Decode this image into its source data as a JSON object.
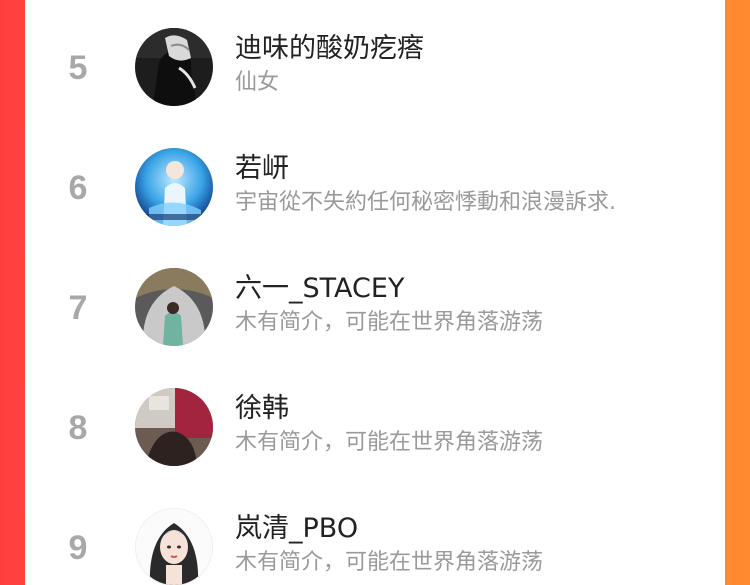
{
  "ranking": {
    "users": [
      {
        "rank": "5",
        "name": "迪味的酸奶疙瘩",
        "bio": "仙女",
        "avatar_icon": "user-avatar-dark-photo"
      },
      {
        "rank": "6",
        "name": "若岍",
        "bio": "宇宙從不失約任何秘密悸動和浪漫訴求.",
        "avatar_icon": "user-avatar-blue-stage-photo"
      },
      {
        "rank": "7",
        "name": "六一_STACEY",
        "bio": "木有简介，可能在世界角落游荡",
        "avatar_icon": "user-avatar-mirror-selfie"
      },
      {
        "rank": "8",
        "name": "徐韩",
        "bio": "木有简介，可能在世界角落游荡",
        "avatar_icon": "user-avatar-room-photo"
      },
      {
        "rank": "9",
        "name": "岚清_PBO",
        "bio": "木有简介，可能在世界角落游荡",
        "avatar_icon": "user-avatar-illustration"
      }
    ]
  },
  "colors": {
    "gradient_left": "#ff3f3f",
    "gradient_right": "#ff8a2f",
    "rank_color": "#a8a8a8",
    "name_color": "#222222",
    "bio_color": "#9a9a9a"
  }
}
